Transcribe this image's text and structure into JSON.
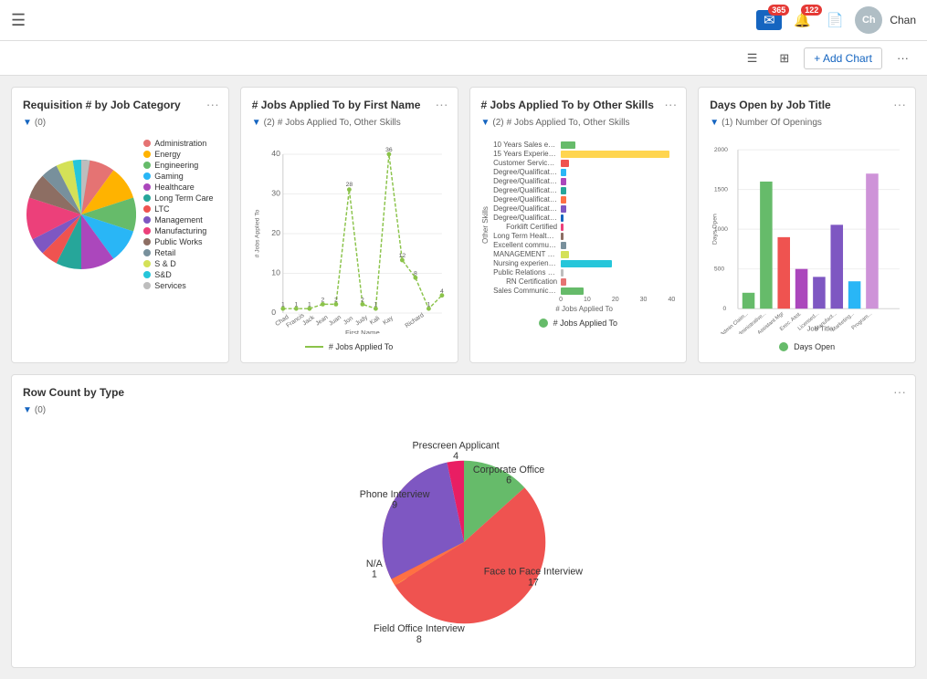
{
  "topbar": {
    "menu_icon": "☰",
    "mail_badge": "365",
    "bell_badge": "122",
    "user_initials": "Ch",
    "user_name": "Chan"
  },
  "toolbar": {
    "list_icon": "☰",
    "grid_icon": "⊞",
    "add_chart_label": "+ Add Chart",
    "more_icon": "···"
  },
  "cards": {
    "req_by_job": {
      "title": "Requisition # by Job Category",
      "filter": "(0)",
      "more": "···",
      "legend": [
        {
          "label": "Administration",
          "color": "#e57373"
        },
        {
          "label": "Energy",
          "color": "#ffb300"
        },
        {
          "label": "Engineering",
          "color": "#66bb6a"
        },
        {
          "label": "Gaming",
          "color": "#29b6f6"
        },
        {
          "label": "Healthcare",
          "color": "#ab47bc"
        },
        {
          "label": "Long Term Care",
          "color": "#26a69a"
        },
        {
          "label": "LTC",
          "color": "#ef5350"
        },
        {
          "label": "Management",
          "color": "#7e57c2"
        },
        {
          "label": "Manufacturing",
          "color": "#ec407a"
        },
        {
          "label": "Public Works",
          "color": "#8d6e63"
        },
        {
          "label": "Retail",
          "color": "#78909c"
        },
        {
          "label": "S & D",
          "color": "#d4e157"
        },
        {
          "label": "S&D",
          "color": "#26c6da"
        },
        {
          "label": "Services",
          "color": "#bdbdbd"
        }
      ]
    },
    "jobs_first_name": {
      "title": "# Jobs Applied To by First Name",
      "filter": "(2)",
      "filter_text": "# Jobs Applied To, Other Skills",
      "more": "···",
      "y_label": "# Jobs Applied To",
      "x_label": "First Name",
      "legend_label": "# Jobs Applied To",
      "names": [
        "Chad",
        "Francis",
        "Jack",
        "Jean",
        "Juan",
        "Jon",
        "Judy",
        "Kali",
        "Kay",
        "Richard"
      ],
      "values": [
        1,
        1,
        1,
        2,
        2,
        28,
        2,
        1,
        36,
        12,
        8,
        1,
        4
      ],
      "data_points": [
        {
          "name": "Chad",
          "val": 1
        },
        {
          "name": "Francis",
          "val": 1
        },
        {
          "name": "Jack",
          "val": 1
        },
        {
          "name": "Jean",
          "val": 2
        },
        {
          "name": "Juan",
          "val": 2
        },
        {
          "name": "Jon",
          "val": 28
        },
        {
          "name": "Judy",
          "val": 2
        },
        {
          "name": "Kali",
          "val": 1
        },
        {
          "name": "Kay",
          "val": 36
        },
        {
          "name": "Richard_1",
          "val": 12
        },
        {
          "name": "Richard_2",
          "val": 8
        },
        {
          "name": "Richard_3",
          "val": 1
        },
        {
          "name": "Richard_4",
          "val": 4
        }
      ]
    },
    "jobs_other_skills": {
      "title": "# Jobs Applied To by Other Skills",
      "filter": "(2)",
      "filter_text": "# Jobs Applied To, Other Skills",
      "more": "···",
      "y_label": "Other Skills",
      "x_label": "# Jobs Applied To",
      "legend_label": "# Jobs Applied To",
      "skills": [
        {
          "label": "10 Years Sales exp...",
          "val": 5,
          "color": "#66bb6a"
        },
        {
          "label": "15 Years Experienc...",
          "val": 38,
          "color": "#ffd54f"
        },
        {
          "label": "Customer Service b...",
          "val": 3,
          "color": "#ef5350"
        },
        {
          "label": "Degree/Qualificatio...",
          "val": 2,
          "color": "#29b6f6"
        },
        {
          "label": "Degree/Qualificatio...",
          "val": 2,
          "color": "#ab47bc"
        },
        {
          "label": "Degree/Qualificatio...",
          "val": 2,
          "color": "#26a69a"
        },
        {
          "label": "Degree/Qualificatio...",
          "val": 2,
          "color": "#ff7043"
        },
        {
          "label": "Degree/Qualificatio...",
          "val": 2,
          "color": "#7e57c2"
        },
        {
          "label": "Degree/Qualificatio...",
          "val": 1,
          "color": "#1565c0"
        },
        {
          "label": "Forklift Certified",
          "val": 1,
          "color": "#ec407a"
        },
        {
          "label": "Long Term Healthc...",
          "val": 1,
          "color": "#8d6e63"
        },
        {
          "label": "Excellent communi...",
          "val": 2,
          "color": "#78909c"
        },
        {
          "label": "MANAGEMENT - 1h...",
          "val": 3,
          "color": "#d4e157"
        },
        {
          "label": "Nursing experience...",
          "val": 18,
          "color": "#26c6da"
        },
        {
          "label": "Public Relations Skill",
          "val": 1,
          "color": "#bdbdbd"
        },
        {
          "label": "RN Certification",
          "val": 2,
          "color": "#e57373"
        },
        {
          "label": "Sales Communicati...",
          "val": 8,
          "color": "#66bb6a"
        }
      ]
    },
    "days_open": {
      "title": "Days Open by Job Title",
      "filter": "(1)",
      "filter_text": "Number Of Openings",
      "more": "···",
      "y_label": "Days Open",
      "x_label": "Job Title",
      "legend_label": "Days Open",
      "bars": [
        {
          "label": "Admin Claim Workers",
          "val": 200,
          "color": "#66bb6a"
        },
        {
          "label": "Administrative Assi...",
          "val": 1600,
          "color": "#66bb6a"
        },
        {
          "label": "Assistant Manager",
          "val": 900,
          "color": "#ef5350"
        },
        {
          "label": "Executive Assistant",
          "val": 500,
          "color": "#ab47bc"
        },
        {
          "label": "Licensed Trust & Colo...",
          "val": 400,
          "color": "#7e57c2"
        },
        {
          "label": "Manufacturing - Safri...",
          "val": 1050,
          "color": "#7e57c2"
        },
        {
          "label": "Marketing & Communi...",
          "val": 350,
          "color": "#29b6f6"
        },
        {
          "label": "Program & Events Fact...",
          "val": 1700,
          "color": "#ce93d8"
        }
      ],
      "max_val": 2000,
      "y_ticks": [
        0,
        500,
        1000,
        1500,
        2000
      ]
    }
  },
  "bottom_card": {
    "title": "Row Count by Type",
    "filter": "(0)",
    "more": "···",
    "slices": [
      {
        "label": "Corporate Office",
        "val": 6,
        "color": "#66bb6a"
      },
      {
        "label": "Face to Face Interview",
        "val": 17,
        "color": "#ef5350"
      },
      {
        "label": "Field Office Interview",
        "val": 8,
        "color": "#ffd54f"
      },
      {
        "label": "N/A",
        "val": 1,
        "color": "#ff7043"
      },
      {
        "label": "Phone Interview",
        "val": 9,
        "color": "#7e57c2"
      },
      {
        "label": "Prescreen Applicant",
        "val": 4,
        "color": "#e91e63"
      }
    ]
  }
}
